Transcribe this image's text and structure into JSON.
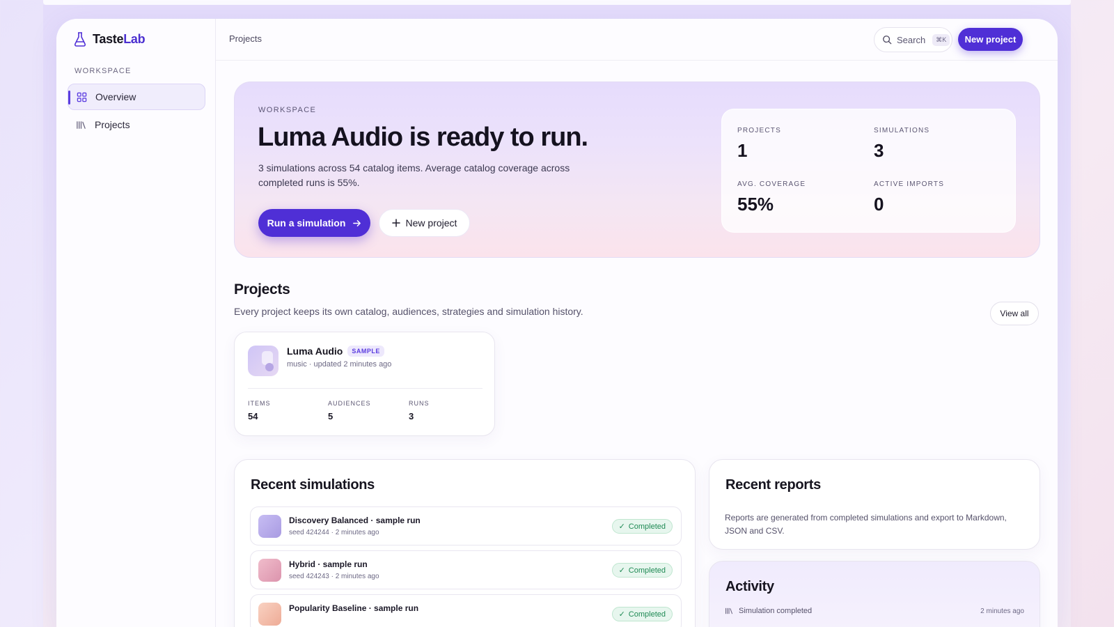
{
  "brand": {
    "name_part1": "Taste",
    "name_part2": "Lab",
    "accent": "#4f2fd6"
  },
  "sidebar": {
    "section_label": "WORKSPACE",
    "items": [
      {
        "label": "Overview",
        "icon": "grid-icon",
        "active": true
      },
      {
        "label": "Projects",
        "icon": "library-icon",
        "active": false
      }
    ]
  },
  "topbar": {
    "breadcrumb": "Projects",
    "search_label": "Search",
    "search_shortcut": "⌘K",
    "new_project_label": "New project"
  },
  "hero": {
    "eyebrow": "WORKSPACE",
    "title": "Luma Audio is ready to run.",
    "description": "3 simulations across 54 catalog items. Average catalog coverage across completed runs is 55%.",
    "run_label": "Run a simulation",
    "new_project_label": "New project",
    "stats": [
      {
        "label": "PROJECTS",
        "value": "1"
      },
      {
        "label": "SIMULATIONS",
        "value": "3"
      },
      {
        "label": "AVG. COVERAGE",
        "value": "55%"
      },
      {
        "label": "ACTIVE IMPORTS",
        "value": "0"
      }
    ]
  },
  "projects": {
    "title": "Projects",
    "description": "Every project keeps its own catalog, audiences, strategies and simulation history.",
    "view_all_label": "View all",
    "cards": [
      {
        "name": "Luma Audio",
        "badge": "SAMPLE",
        "meta": "music · updated 2 minutes ago",
        "stats": [
          {
            "label": "ITEMS",
            "value": "54"
          },
          {
            "label": "AUDIENCES",
            "value": "5"
          },
          {
            "label": "RUNS",
            "value": "3"
          }
        ]
      }
    ]
  },
  "recent_simulations": {
    "title": "Recent simulations",
    "rows": [
      {
        "name": "Discovery Balanced · sample run",
        "meta": "seed 424244 · 2 minutes ago",
        "status": "Completed",
        "color": "#b9aeeb"
      },
      {
        "name": "Hybrid · sample run",
        "meta": "seed 424243 · 2 minutes ago",
        "status": "Completed",
        "color": "#e9a9bd"
      },
      {
        "name": "Popularity Baseline · sample run",
        "meta": "",
        "status": "Completed",
        "color": "#f3c1b0"
      }
    ]
  },
  "recent_reports": {
    "title": "Recent reports",
    "description": "Reports are generated from completed simulations and export to Markdown, JSON and CSV."
  },
  "activity": {
    "title": "Activity",
    "items": [
      {
        "text": "Simulation completed",
        "time": "2 minutes ago",
        "icon": "library-icon"
      }
    ]
  }
}
